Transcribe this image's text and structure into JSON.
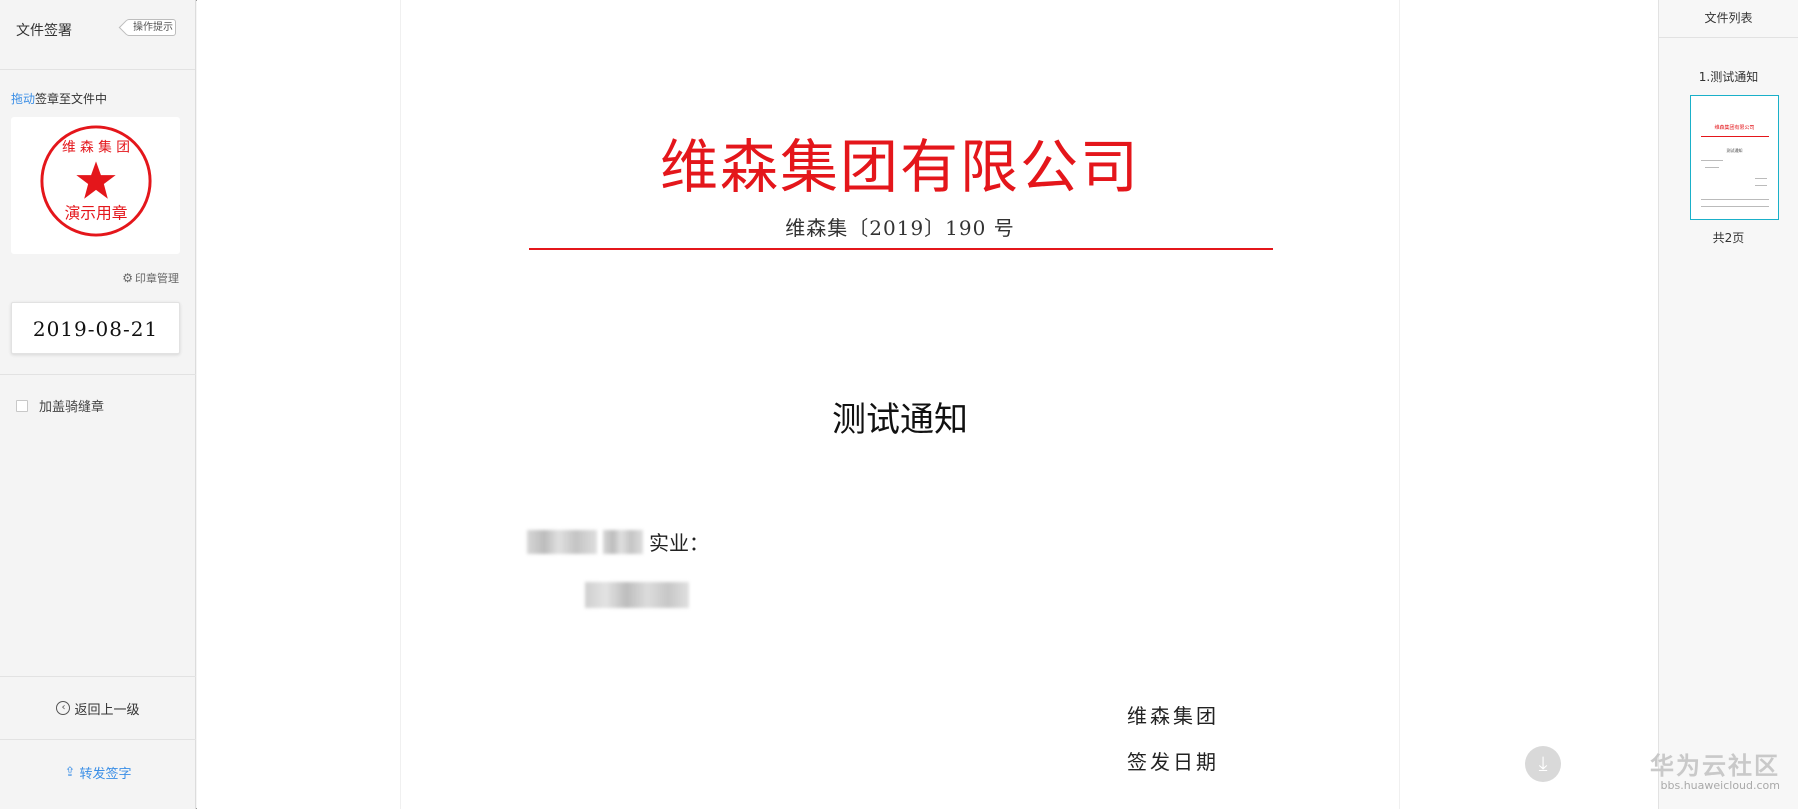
{
  "left_panel": {
    "title": "文件签署",
    "hint_button": "操作提示",
    "drag_tip_highlight": "拖动",
    "drag_tip_rest": "签章至文件中",
    "seal": {
      "top_text": "维 森 集 团",
      "bottom_text": "演示用章",
      "color": "#e4161b"
    },
    "seal_manage": "印章管理",
    "date_stamp": "2019-08-21",
    "riding_seal_label": "加盖骑缝章",
    "riding_seal_checked": false,
    "back_label": "返回上一级",
    "forward_label": "转发签字"
  },
  "document": {
    "company": "维森集团有限公司",
    "doc_number": "维森集〔2019〕190 号",
    "title": "测试通知",
    "recipient_suffix": "实业：",
    "sign_group": "维森集团",
    "sign_date_label": "签发日期"
  },
  "right_panel": {
    "header": "文件列表",
    "file_name": "1.测试通知",
    "page_count": "共2页"
  },
  "watermark": {
    "main": "华为云社区",
    "sub": "bbs.huaweicloud.com"
  },
  "colors": {
    "accent": "#3a8ee6",
    "doc_red": "#e4161b",
    "thumb_border": "#1ab0c9"
  }
}
